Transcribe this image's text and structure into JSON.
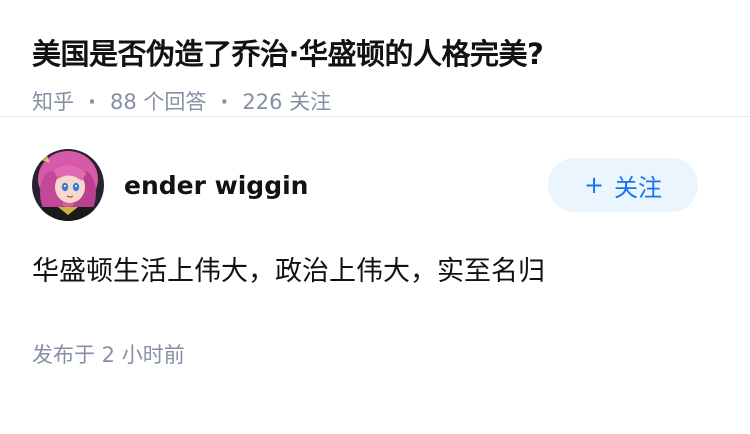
{
  "question": {
    "title": "美国是否伪造了乔治·华盛顿的人格完美?",
    "source": "知乎",
    "answer_count": "88 个回答",
    "follow_count": "226 关注",
    "separator": "·"
  },
  "answer": {
    "author": {
      "name": "ender wiggin",
      "avatar": "avatar-anime-girl-pink-hair"
    },
    "follow_button": {
      "plus": "+",
      "label": "关注"
    },
    "content": "华盛顿生活上伟大，政治上伟大，实至名归",
    "published": "发布于 2 小时前"
  },
  "colors": {
    "meta_gray": "#8590a6",
    "follow_bg": "#ebf5fd",
    "follow_text": "#1772f6",
    "divider": "#ebebeb"
  }
}
